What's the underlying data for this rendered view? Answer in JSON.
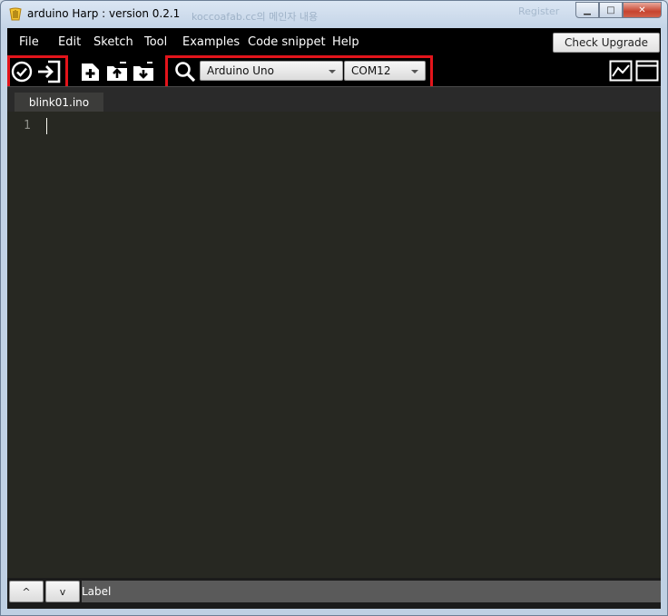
{
  "window": {
    "title": "arduino Harp : version 0.2.1",
    "background_title_fragment": "koccoafab.cc의 메인자 내용",
    "background_title_fragment2": "Register",
    "caption_min": "▁",
    "caption_max": "□",
    "caption_close": "✕"
  },
  "menu": {
    "items": [
      "File",
      "Edit",
      "Sketch",
      "Tool",
      "Examples",
      "Code snippet",
      "Help"
    ],
    "check_upgrade": "Check Upgrade"
  },
  "toolbar": {
    "board": "Arduino Uno",
    "port": "COM12",
    "icons": [
      "verify-icon",
      "upload-icon",
      "new-file-icon",
      "open-folder-icon",
      "save-folder-icon",
      "search-icon",
      "serial-plotter-icon",
      "serial-monitor-icon"
    ]
  },
  "tabs": [
    {
      "label": "blink01.ino"
    }
  ],
  "editor": {
    "line_numbers": [
      "1"
    ]
  },
  "statusbar": {
    "up_button": "^",
    "down_button": "v",
    "label": "Label"
  },
  "colors": {
    "highlight_box": "#e3141b",
    "editor_background": "#272822",
    "chrome_background": "#000000"
  }
}
